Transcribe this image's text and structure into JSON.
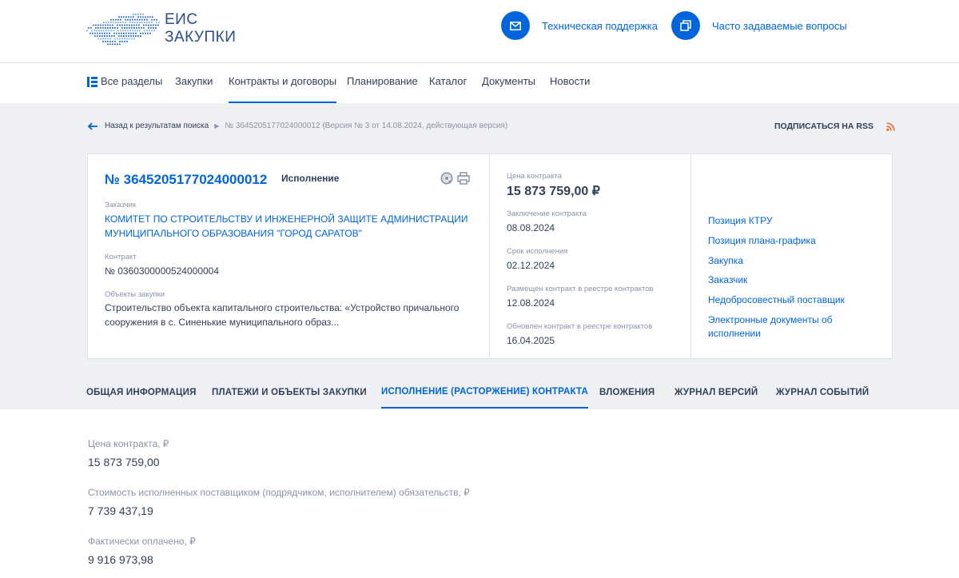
{
  "logo": {
    "line1": "ЕИС",
    "line2": "ЗАКУПКИ"
  },
  "header_links": {
    "support": "Техническая поддержка",
    "faq": "Часто задаваемые вопросы"
  },
  "nav": {
    "all": "Все разделы",
    "items": [
      "Закупки",
      "Контракты и договоры",
      "Планирование",
      "Каталог",
      "Документы",
      "Новости"
    ],
    "active": "Контракты и договоры"
  },
  "breadcrumb": {
    "back": "Назад к результатам поиска",
    "current": "№ 3645205177024000012 (Версия № 3 от 14.08.2024, действующая версия)"
  },
  "rss": "ПОДПИСАТЬСЯ НА RSS",
  "card": {
    "reg_number": "№ 3645205177024000012",
    "status": "Исполнение",
    "customer_label": "Заказчик",
    "customer_line1": "КОМИТЕТ ПО СТРОИТЕЛЬСТВУ И ИНЖЕНЕРНОЙ ЗАЩИТЕ АДМИНИСТРАЦИИ",
    "customer_line2": "МУНИЦИПАЛЬНОГО ОБРАЗОВАНИЯ \"ГОРОД САРАТОВ\"",
    "contract_label": "Контракт",
    "contract_value": "№ 0360300000524000004",
    "objects_label": "Объекты закупки",
    "objects_line1": "Строительство объекта капитального строительства: «Устройство причального",
    "objects_line2": "сооружения в с. Синенькие муниципального образ...",
    "price_label": "Цена контракта",
    "price_value": "15 873 759,00 ₽",
    "conclusion_label": "Заключение контракта",
    "conclusion_value": "08.08.2024",
    "term_label": "Срок исполнения",
    "term_value": "02.12.2024",
    "posted_label": "Размещен контракт в реестре контрактов",
    "posted_value": "12.08.2024",
    "updated_label": "Обновлен контракт в реестре контрактов",
    "updated_value": "16.04.2025",
    "side_links": [
      "Позиция КТРУ",
      "Позиция плана-графика",
      "Закупка",
      "Заказчик",
      "Недобросовестный поставщик"
    ],
    "side_link_last_line1": "Электронные документы об",
    "side_link_last_line2": "исполнении"
  },
  "tabs": [
    "ОБЩАЯ ИНФОРМАЦИЯ",
    "ПЛАТЕЖИ И ОБЪЕКТЫ ЗАКУПКИ",
    "ИСПОЛНЕНИЕ (РАСТОРЖЕНИЕ) КОНТРАКТА",
    "ВЛОЖЕНИЯ",
    "ЖУРНАЛ ВЕРСИЙ",
    "ЖУРНАЛ СОБЫТИЙ"
  ],
  "active_tab": "ИСПОЛНЕНИЕ (РАСТОРЖЕНИЕ) КОНТРАКТА",
  "fields": [
    {
      "label": "Цена контракта, ₽",
      "value": "15 873 759,00"
    },
    {
      "label": "Стоимость исполненных поставщиком (подрядчиком, исполнителем) обязательств, ₽",
      "value": "7 739 437,19"
    },
    {
      "label": "Фактически оплачено, ₽",
      "value": "9 916 973,98"
    }
  ],
  "colors": {
    "accent": "#0065dd",
    "text": "#334059",
    "muted": "#8a94a6",
    "band": "#eef0f3",
    "rss": "#f26522"
  },
  "icons": [
    "russia-map-logo",
    "mail-icon",
    "copy-icon",
    "menu-grid-icon",
    "arrow-left-icon",
    "rss-icon",
    "at-icon",
    "print-icon"
  ]
}
